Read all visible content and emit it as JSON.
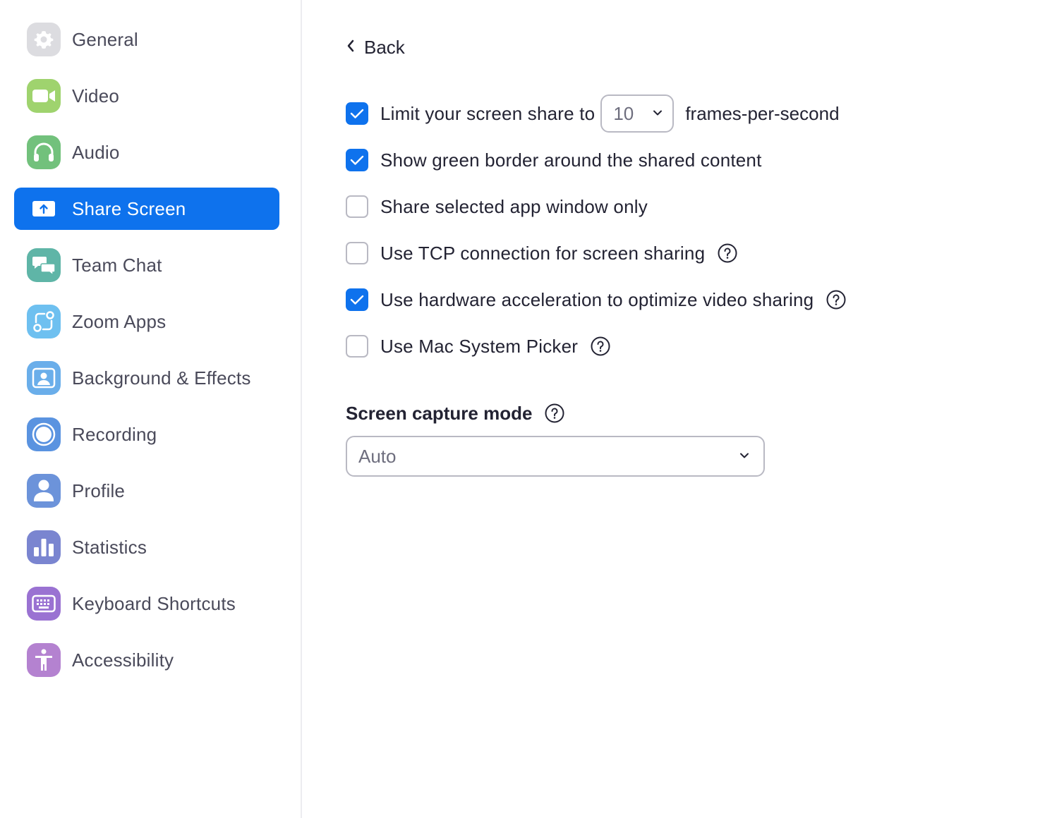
{
  "sidebar": {
    "items": [
      {
        "label": "General",
        "icon": "gear-icon",
        "color": "#d4d4d8"
      },
      {
        "label": "Video",
        "icon": "video-camera-icon",
        "color": "#9fd36e"
      },
      {
        "label": "Audio",
        "icon": "headphones-icon",
        "color": "#72c17c"
      },
      {
        "label": "Share Screen",
        "icon": "share-screen-icon",
        "color": "#0e72ed",
        "active": true
      },
      {
        "label": "Team Chat",
        "icon": "chat-bubbles-icon",
        "color": "#5fb5a7"
      },
      {
        "label": "Zoom Apps",
        "icon": "apps-icon",
        "color": "#6ec0f0"
      },
      {
        "label": "Background & Effects",
        "icon": "person-frame-icon",
        "color": "#6aaeea"
      },
      {
        "label": "Recording",
        "icon": "record-icon",
        "color": "#5a93e0"
      },
      {
        "label": "Profile",
        "icon": "profile-icon",
        "color": "#6c93da"
      },
      {
        "label": "Statistics",
        "icon": "bar-chart-icon",
        "color": "#7a85d0"
      },
      {
        "label": "Keyboard Shortcuts",
        "icon": "keyboard-icon",
        "color": "#9a72d2"
      },
      {
        "label": "Accessibility",
        "icon": "accessibility-icon",
        "color": "#b482d0"
      }
    ]
  },
  "main": {
    "back_label": "Back",
    "fps": {
      "checked": true,
      "label": "Limit your screen share to",
      "value": "10",
      "suffix": "frames-per-second"
    },
    "options": [
      {
        "label": "Show green border around the shared content",
        "checked": true,
        "help": false
      },
      {
        "label": "Share selected app window only",
        "checked": false,
        "help": false
      },
      {
        "label": "Use TCP connection for screen sharing",
        "checked": false,
        "help": true
      },
      {
        "label": "Use hardware acceleration to optimize video sharing",
        "checked": true,
        "help": true
      },
      {
        "label": "Use Mac System Picker",
        "checked": false,
        "help": true
      }
    ],
    "capture_mode": {
      "title": "Screen capture mode",
      "value": "Auto"
    }
  },
  "colors": {
    "accent": "#0e72ed",
    "text": "#232333",
    "border": "#b9b9c3"
  }
}
